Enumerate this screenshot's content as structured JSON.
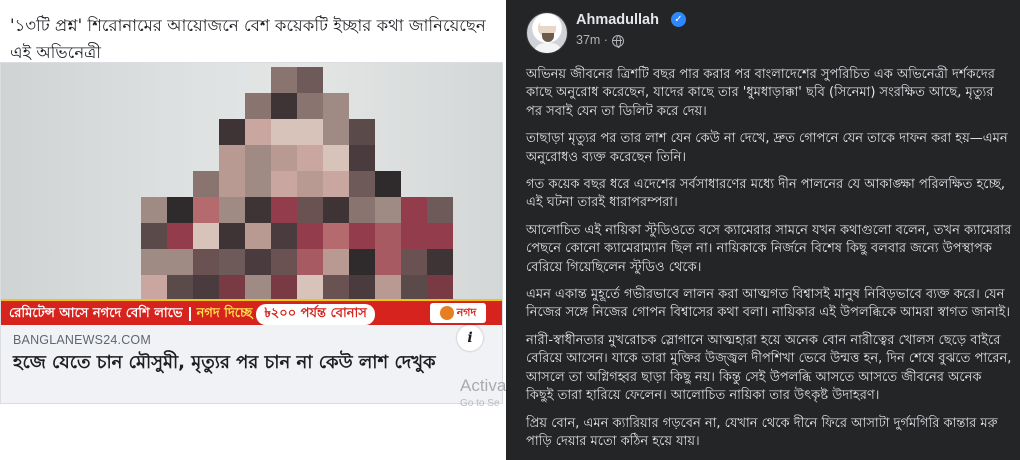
{
  "left_card": {
    "caption": "'১৩টি প্রশ্ন' শিরোনামের আয়োজনে বেশ কয়েকটি ইচ্ছার কথা জানিয়েছেন এই অভিনেত্রী",
    "ticker": {
      "part1": "রেমিটেন্স আসে নগদে বেশি লাভে",
      "part2": "নগদ দিচ্ছে",
      "bonus": "৳২০০ পর্যন্ত বোনাস",
      "channel": "নগদ"
    },
    "domain": "BANGLANEWS24.COM",
    "headline": "হজে যেতে চান মৌসুমী, মৃত্যুর পর চান না কেউ লাশ দেখুক",
    "info_glyph": "i",
    "watermark": "Activa",
    "watermark_sub": "Go to Se"
  },
  "post": {
    "author": "Ahmadullah",
    "verified_glyph": "✓",
    "time": "37m ·",
    "paragraphs": [
      "অভিনয় জীবনের ত্রিশটি বছর পার করার পর বাংলাদেশের সুপরিচিত এক অভিনেত্রী দর্শকদের কাছে অনুরোধ করেছেন, যাদের কাছে তার 'ধুমধাড়াক্কা' ছবি (সিনেমা) সংরক্ষিত আছে, মৃত্যুর পর সবাই যেন তা ডিলিট করে দেয়।",
      "তাছাড়া মৃত্যুর পর তার লাশ যেন কেউ না দেখে, দ্রুত গোপনে যেন তাকে দাফন করা হয়—এমন অনুরোধও ব্যক্ত করেছেন তিনি।",
      "গত কয়েক বছর ধরে এদেশের সর্বসাধারণের মধ্যে দীন পালনের যে আকাঙ্ক্ষা পরিলক্ষিত হচ্ছে, এই ঘটনা তারই ধারাপরম্পরা।",
      "আলোচিত এই নায়িকা স্টুডিওতে বসে ক্যামেরার সামনে যখন কথাগুলো বলেন, তখন ক্যামেরার পেছনে কোনো ক্যামেরাম্যান ছিল না। নায়িকাকে নির্জনে বিশেষ কিছু বলবার জন্যে উপস্থাপক বেরিয়ে গিয়েছিলেন স্টুডিও থেকে।",
      "এমন একান্ত মুহূর্তে গভীরভাবে লালন করা আত্মগত বিশ্বাসই মানুষ নিবিড়ভাবে ব্যক্ত করে। যেন নিজের সঙ্গে নিজের গোপন বিশ্বাসের কথা বলা। নায়িকার এই উপলব্ধিকে আমরা স্বাগত জানাই।",
      "নারী-স্বাধীনতার মুখরোচক স্লোগানে আত্মহারা হয়ে অনেক বোন নারীত্বের খোলস ছেড়ে বাইরে বেরিয়ে আসেন। যাকে তারা মুক্তির উজ্জ্বল দীপশিখা ভেবে উন্মত্ত হন, দিন শেষে বুঝতে পারেন, আসলে তা অগ্নিগহ্বর ছাড়া কিছু নয়। কিন্তু সেই উপলব্ধি আসতে আসতে জীবনের অনেক কিছুই তারা হারিয়ে ফেলেন। আলোচিত নায়িকা তার উৎকৃষ্ট উদাহরণ।",
      "প্রিয় বোন, এমন ক্যারিয়ার গড়বেন না, যেখান থেকে দীনে ফিরে আসাটা দুর্গমগিরি কান্তার মরু পাড়ি দেয়ার মতো কঠিন হয়ে যায়।"
    ]
  }
}
